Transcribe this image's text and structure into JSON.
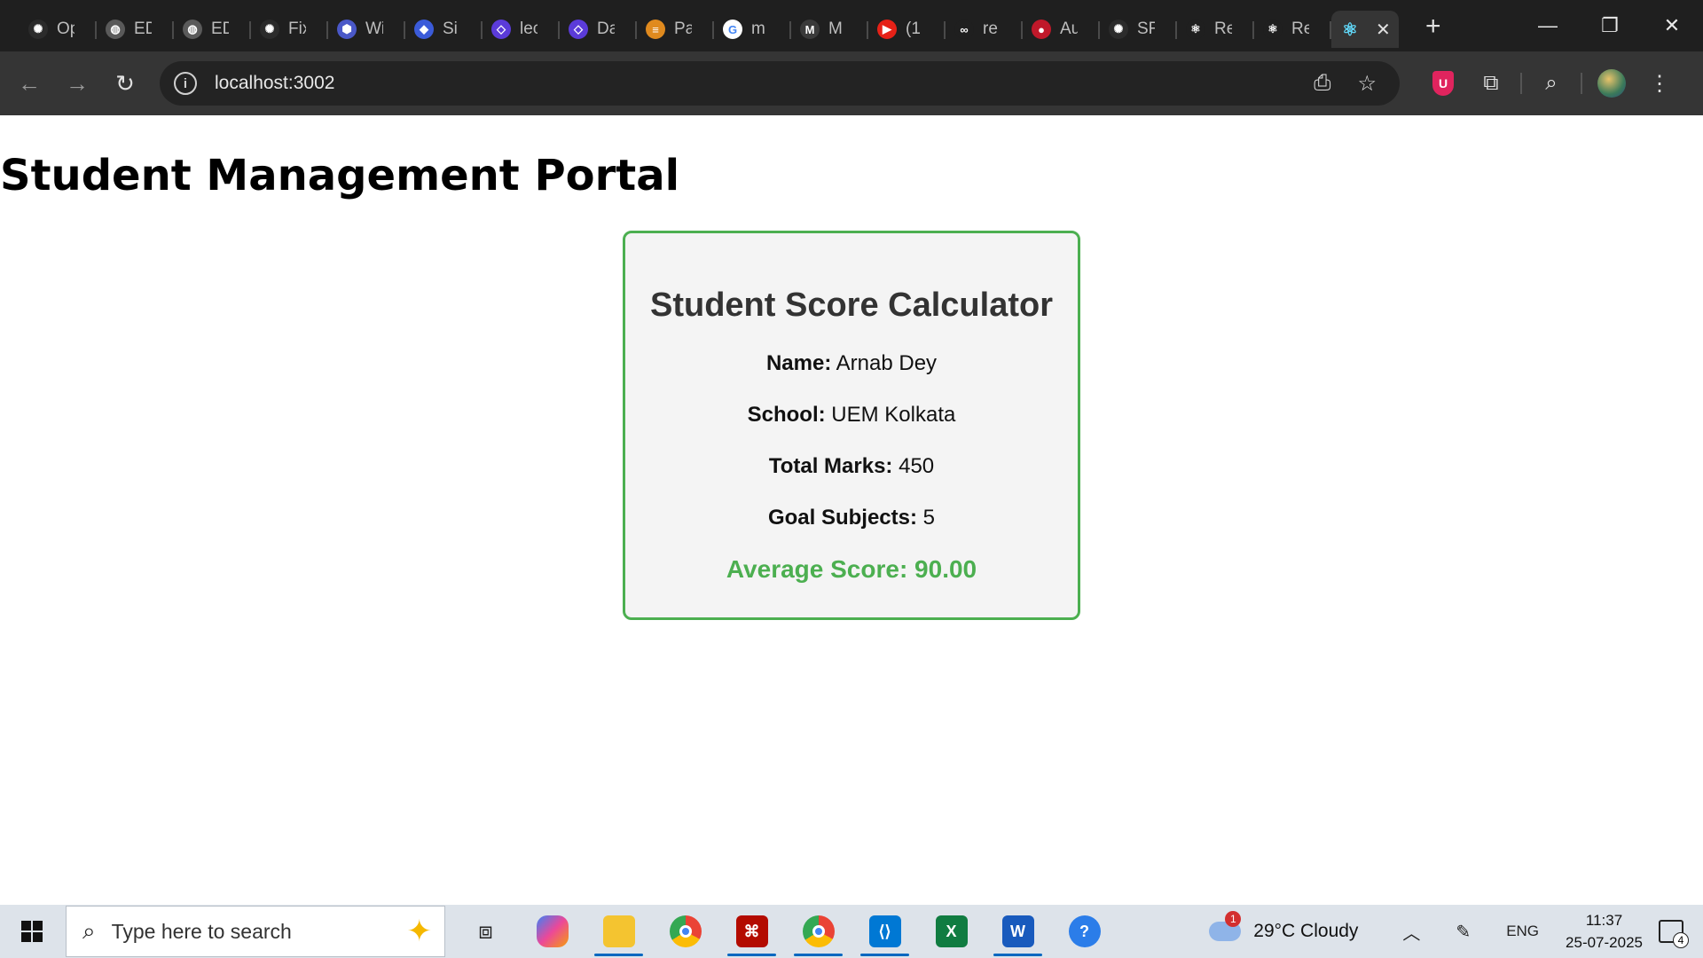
{
  "browser": {
    "tabs": [
      {
        "label": "Op",
        "icon": "openai-icon",
        "color": "#2b2b2b",
        "glyph": "✺"
      },
      {
        "label": "ED",
        "icon": "globe-icon",
        "color": "#5a5a5a",
        "glyph": "◍"
      },
      {
        "label": "ED",
        "icon": "globe-icon",
        "color": "#5a5a5a",
        "glyph": "◍"
      },
      {
        "label": "Fix",
        "icon": "openai-icon",
        "color": "#2b2b2b",
        "glyph": "✺"
      },
      {
        "label": "Wi",
        "icon": "cube-icon",
        "color": "#4a58c8",
        "glyph": "⬢"
      },
      {
        "label": "Si",
        "icon": "cube-icon",
        "color": "#3b5bd9",
        "glyph": "◆"
      },
      {
        "label": "lec",
        "icon": "code-icon",
        "color": "#5b3bd9",
        "glyph": "◇"
      },
      {
        "label": "Da",
        "icon": "code-icon",
        "color": "#5b3bd9",
        "glyph": "◇"
      },
      {
        "label": "Pa",
        "icon": "stack-icon",
        "color": "#e08a1e",
        "glyph": "≡"
      },
      {
        "label": "m",
        "icon": "google-icon",
        "color": "#ffffff",
        "glyph": "G"
      },
      {
        "label": "M",
        "icon": "m-logo-icon",
        "color": "#3a3a3a",
        "glyph": "M"
      },
      {
        "label": "(1",
        "icon": "youtube-icon",
        "color": "#e62117",
        "glyph": "▶"
      },
      {
        "label": "re",
        "icon": "infinity-icon",
        "color": "#1f1f1f",
        "glyph": "∞"
      },
      {
        "label": "Au",
        "icon": "record-icon",
        "color": "#c0182a",
        "glyph": "●"
      },
      {
        "label": "SF",
        "icon": "openai-icon",
        "color": "#2b2b2b",
        "glyph": "✺"
      },
      {
        "label": "Re",
        "icon": "react-icon",
        "color": "#1f1f1f",
        "glyph": "⚛"
      },
      {
        "label": "Re",
        "icon": "react-icon",
        "color": "#1f1f1f",
        "glyph": "⚛"
      }
    ],
    "active_tab_icon": "react-icon",
    "url": "localhost:3002"
  },
  "page": {
    "title": "Student Management Portal",
    "card": {
      "title": "Student Score Calculator",
      "fields": [
        {
          "label": "Name:",
          "value": "Arnab Dey"
        },
        {
          "label": "School:",
          "value": "UEM Kolkata"
        },
        {
          "label": "Total Marks:",
          "value": "450"
        },
        {
          "label": "Goal Subjects:",
          "value": "5"
        }
      ],
      "average_label": "Average Score: 90.00",
      "accent_color": "#4caf50"
    }
  },
  "taskbar": {
    "search_placeholder": "Type here to search",
    "weather": "29°C  Cloudy",
    "weather_badge": "1",
    "language": "ENG",
    "time": "11:37",
    "date": "25-07-2025",
    "notifications": "4"
  }
}
